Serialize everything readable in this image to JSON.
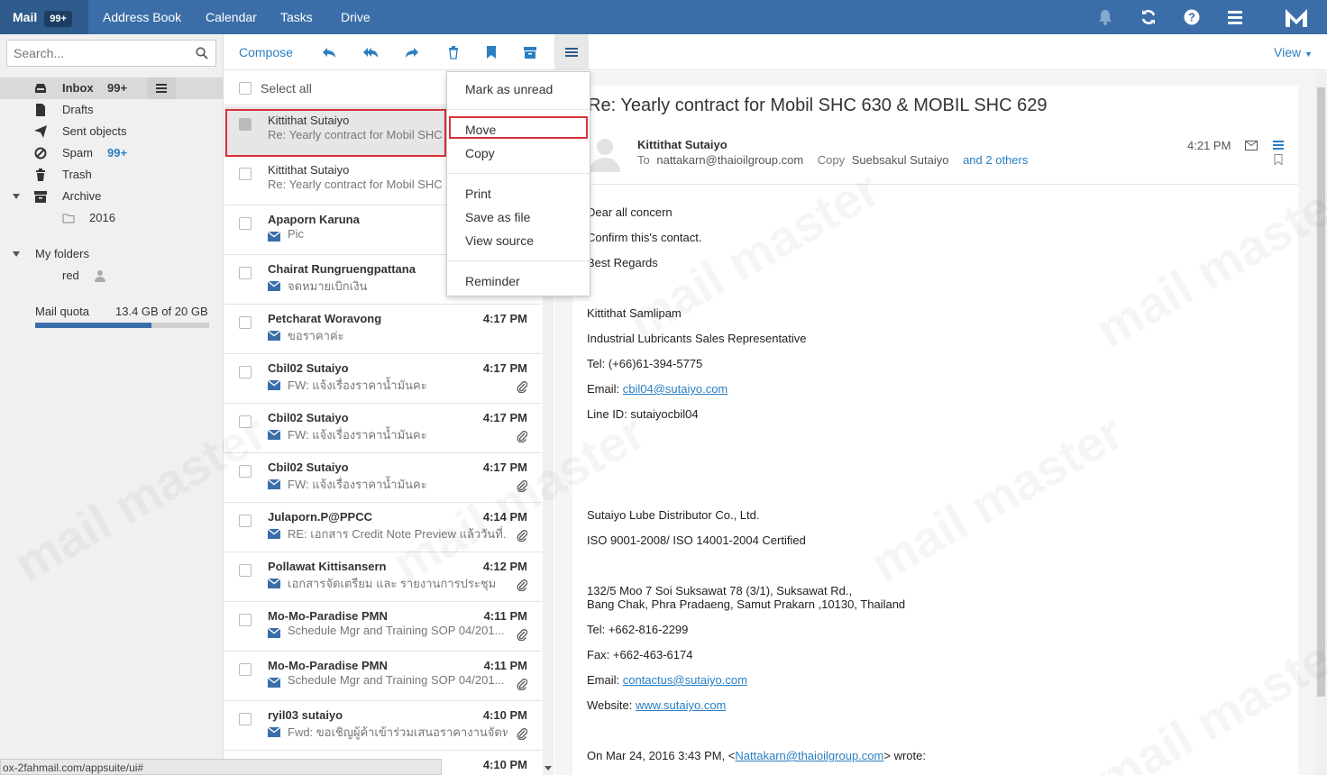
{
  "topbar": {
    "tabs": [
      {
        "label": "Mail",
        "badge": "99+"
      },
      {
        "label": "Address Book"
      },
      {
        "label": "Calendar"
      },
      {
        "label": "Tasks"
      },
      {
        "label": "Drive"
      }
    ],
    "icons": [
      "bell-icon",
      "refresh-icon",
      "help-icon",
      "menu-icon",
      "mailmaster-logo"
    ]
  },
  "sidebar": {
    "search_placeholder": "Search...",
    "folders": [
      {
        "label": "Inbox",
        "count": "99+",
        "icon": "inbox-icon",
        "selected": true
      },
      {
        "label": "Drafts",
        "icon": "file-icon"
      },
      {
        "label": "Sent objects",
        "icon": "send-icon"
      },
      {
        "label": "Spam",
        "count": "99+",
        "icon": "block-icon"
      },
      {
        "label": "Trash",
        "icon": "trash-icon"
      },
      {
        "label": "Archive",
        "icon": "archive-icon"
      },
      {
        "label": "2016",
        "icon": "folder-icon"
      }
    ],
    "my_folders_label": "My folders",
    "custom_folders": [
      {
        "label": "red",
        "icon": "user-icon"
      }
    ],
    "quota_label": "Mail quota",
    "quota_value": "13.4 GB of 20 GB",
    "quota_fraction": 0.67,
    "status_url": "ox-2fahmail.com/appsuite/ui#"
  },
  "toolbar": {
    "compose": "Compose",
    "icons": [
      "reply-icon",
      "reply-all-icon",
      "forward-icon",
      "delete-icon",
      "flag-icon",
      "archive-icon",
      "more-icon"
    ],
    "view": "View"
  },
  "list": {
    "select_all": "Select all",
    "items": [
      {
        "from": "Kittithat Sutaiyo",
        "subject": "Re: Yearly contract for Mobil SHC",
        "time": "",
        "read": true,
        "checked": true,
        "attachment": false
      },
      {
        "from": "Kittithat Sutaiyo",
        "subject": "Re: Yearly contract for Mobil SHC",
        "time": "",
        "read": true,
        "checked": false,
        "attachment": false
      },
      {
        "from": "Apaporn Karuna",
        "subject": "Pic",
        "time": "",
        "read": false,
        "checked": false,
        "attachment": false
      },
      {
        "from": "Chairat Rungruengpattana",
        "subject": "จดหมายเบิกเงิน",
        "time": "",
        "read": false,
        "checked": false,
        "attachment": false
      },
      {
        "from": "Petcharat Woravong",
        "subject": "ขอราคาค่ะ",
        "time": "4:17 PM",
        "read": false,
        "checked": false,
        "attachment": false
      },
      {
        "from": "Cbil02 Sutaiyo",
        "subject": "FW: แจ้งเรื่องราคาน้ำมันคะ",
        "time": "4:17 PM",
        "read": false,
        "checked": false,
        "attachment": true
      },
      {
        "from": "Cbil02 Sutaiyo",
        "subject": "FW: แจ้งเรื่องราคาน้ำมันคะ",
        "time": "4:17 PM",
        "read": false,
        "checked": false,
        "attachment": true
      },
      {
        "from": "Cbil02 Sutaiyo",
        "subject": "FW: แจ้งเรื่องราคาน้ำมันคะ",
        "time": "4:17 PM",
        "read": false,
        "checked": false,
        "attachment": true
      },
      {
        "from": "Julaporn.P@PPCC",
        "subject": "RE: เอกสาร Credit Note Preview แล้ววันที่...",
        "time": "4:14 PM",
        "read": false,
        "checked": false,
        "attachment": true
      },
      {
        "from": "Pollawat Kittisansern",
        "subject": "เอกสารจัดเตรียม และ รายงานการประชุม",
        "time": "4:12 PM",
        "read": false,
        "checked": false,
        "attachment": true
      },
      {
        "from": "Mo-Mo-Paradise PMN",
        "subject": "Schedule Mgr and Training SOP 04/201...",
        "time": "4:11 PM",
        "read": false,
        "checked": false,
        "attachment": true
      },
      {
        "from": "Mo-Mo-Paradise PMN",
        "subject": "Schedule Mgr and Training SOP 04/201...",
        "time": "4:11 PM",
        "read": false,
        "checked": false,
        "attachment": true
      },
      {
        "from": "ryil03 sutaiyo",
        "subject": "Fwd: ขอเชิญผู้ค้าเข้าร่วมเสนอราคางานจัดหา...",
        "time": "4:10 PM",
        "read": false,
        "checked": false,
        "attachment": true
      },
      {
        "from": "",
        "subject": "",
        "time": "4:10 PM",
        "read": false,
        "checked": false,
        "attachment": false
      }
    ]
  },
  "context_menu": {
    "items": [
      "Mark as unread",
      "Move",
      "Copy",
      "Print",
      "Save as file",
      "View source",
      "Reminder"
    ]
  },
  "reader": {
    "subject": "Re: Yearly contract for Mobil SHC 630 & MOBIL SHC 629",
    "from": "Kittithat Sutaiyo",
    "to_label": "To",
    "to": "nattakarn@thaioilgroup.com",
    "copy_label": "Copy",
    "copy": "Suebsakul Sutaiyo",
    "others": "and 2 others",
    "time": "4:21 PM",
    "body": [
      {
        "text": "Dear all concern"
      },
      {
        "text": "Confirm this's contact."
      },
      {
        "text": "Best Regards"
      },
      {
        "text": "Kittithat Samlipam"
      },
      {
        "text": "Industrial Lubricants Sales Representative"
      },
      {
        "text": "Tel: (+66)61-394-5775"
      },
      {
        "prefix": "Email: ",
        "link": "cbil04@sutaiyo.com"
      },
      {
        "text": "Line ID: sutaiyocbil04"
      },
      {
        "text": "Sutaiyo Lube Distributor Co., Ltd."
      },
      {
        "text": "ISO 9001-2008/ ISO 14001-2004 Certified"
      },
      {
        "text": "132/5 Moo 7 Soi Suksawat 78 (3/1), Suksawat Rd.,"
      },
      {
        "text": "Bang Chak, Phra Pradaeng, Samut Prakarn ,10130,  Thailand"
      },
      {
        "text": "Tel: +662-816-2299"
      },
      {
        "text": "Fax: +662-463-6174"
      },
      {
        "prefix": "Email: ",
        "link": "contactus@sutaiyo.com"
      },
      {
        "prefix": "Website: ",
        "link": "www.sutaiyo.com"
      },
      {
        "prefix": "On Mar 24, 2016 3:43 PM, <",
        "link": "Nattakarn@thaioilgroup.com",
        "suffix": "> wrote:"
      }
    ]
  },
  "watermark": "mail master",
  "colors": {
    "topbar": "#3b6ea8",
    "accent": "#2a7fc3",
    "highlight_box": "#d9333a"
  }
}
